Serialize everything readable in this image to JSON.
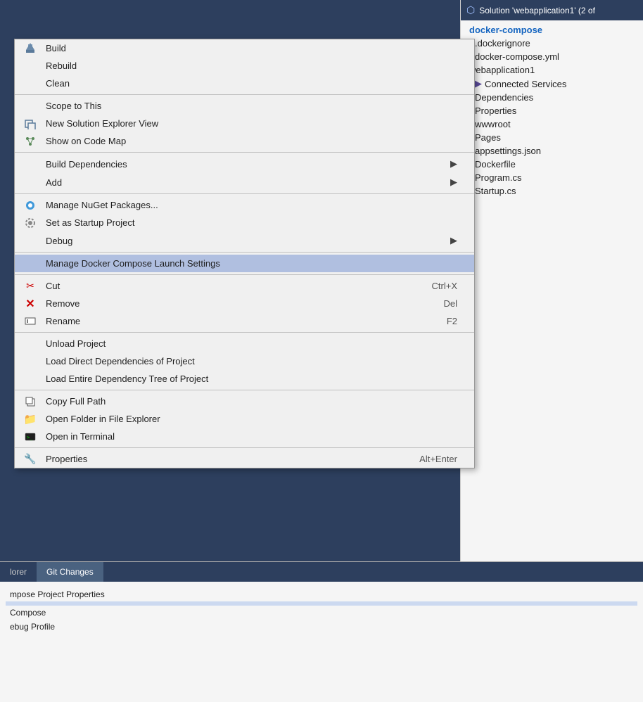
{
  "solution_explorer": {
    "header": "Solution 'webapplication1' (2 of",
    "tree_items": [
      {
        "label": "docker-compose",
        "level": 0,
        "bold": true
      },
      {
        "label": ".dockerignore",
        "level": 1
      },
      {
        "label": "docker-compose.yml",
        "level": 1
      },
      {
        "label": "webapplication1",
        "level": 0
      },
      {
        "label": "Connected Services",
        "level": 1
      },
      {
        "label": "Dependencies",
        "level": 1
      },
      {
        "label": "Properties",
        "level": 1
      },
      {
        "label": "wwwroot",
        "level": 1
      },
      {
        "label": "Pages",
        "level": 1
      },
      {
        "label": "appsettings.json",
        "level": 1
      },
      {
        "label": "Dockerfile",
        "level": 1
      },
      {
        "label": "Program.cs",
        "level": 1
      },
      {
        "label": "Startup.cs",
        "level": 1
      }
    ]
  },
  "context_menu": {
    "items": [
      {
        "id": "build",
        "label": "Build",
        "shortcut": "",
        "has_arrow": false,
        "icon": "build-icon",
        "divider_after": false
      },
      {
        "id": "rebuild",
        "label": "Rebuild",
        "shortcut": "",
        "has_arrow": false,
        "icon": "",
        "divider_after": false
      },
      {
        "id": "clean",
        "label": "Clean",
        "shortcut": "",
        "has_arrow": false,
        "icon": "",
        "divider_after": true
      },
      {
        "id": "scope-to-this",
        "label": "Scope to This",
        "shortcut": "",
        "has_arrow": false,
        "icon": "",
        "divider_after": false
      },
      {
        "id": "new-solution-explorer-view",
        "label": "New Solution Explorer View",
        "shortcut": "",
        "has_arrow": false,
        "icon": "new-solution-icon",
        "divider_after": false
      },
      {
        "id": "show-on-code-map",
        "label": "Show on Code Map",
        "shortcut": "",
        "has_arrow": false,
        "icon": "code-map-icon",
        "divider_after": true
      },
      {
        "id": "build-dependencies",
        "label": "Build Dependencies",
        "shortcut": "",
        "has_arrow": true,
        "icon": "",
        "divider_after": false
      },
      {
        "id": "add",
        "label": "Add",
        "shortcut": "",
        "has_arrow": true,
        "icon": "",
        "divider_after": true
      },
      {
        "id": "manage-nuget",
        "label": "Manage NuGet Packages...",
        "shortcut": "",
        "has_arrow": false,
        "icon": "nuget-icon",
        "divider_after": false
      },
      {
        "id": "set-startup",
        "label": "Set as Startup Project",
        "shortcut": "",
        "has_arrow": false,
        "icon": "gear-icon",
        "divider_after": false
      },
      {
        "id": "debug",
        "label": "Debug",
        "shortcut": "",
        "has_arrow": true,
        "icon": "",
        "divider_after": true
      },
      {
        "id": "manage-docker-compose",
        "label": "Manage Docker Compose Launch Settings",
        "shortcut": "",
        "has_arrow": false,
        "icon": "",
        "divider_after": true,
        "highlighted": true
      },
      {
        "id": "cut",
        "label": "Cut",
        "shortcut": "Ctrl+X",
        "has_arrow": false,
        "icon": "cut-icon",
        "divider_after": false
      },
      {
        "id": "remove",
        "label": "Remove",
        "shortcut": "Del",
        "has_arrow": false,
        "icon": "remove-icon",
        "divider_after": false
      },
      {
        "id": "rename",
        "label": "Rename",
        "shortcut": "F2",
        "has_arrow": false,
        "icon": "rename-icon",
        "divider_after": true
      },
      {
        "id": "unload-project",
        "label": "Unload Project",
        "shortcut": "",
        "has_arrow": false,
        "icon": "",
        "divider_after": false
      },
      {
        "id": "load-direct-deps",
        "label": "Load Direct Dependencies of Project",
        "shortcut": "",
        "has_arrow": false,
        "icon": "",
        "divider_after": false
      },
      {
        "id": "load-entire-dep-tree",
        "label": "Load Entire Dependency Tree of Project",
        "shortcut": "",
        "has_arrow": false,
        "icon": "",
        "divider_after": true
      },
      {
        "id": "copy-full-path",
        "label": "Copy Full Path",
        "shortcut": "",
        "has_arrow": false,
        "icon": "copy-icon",
        "divider_after": false
      },
      {
        "id": "open-folder",
        "label": "Open Folder in File Explorer",
        "shortcut": "",
        "has_arrow": false,
        "icon": "folder-icon",
        "divider_after": false
      },
      {
        "id": "open-terminal",
        "label": "Open in Terminal",
        "shortcut": "",
        "has_arrow": false,
        "icon": "terminal-icon",
        "divider_after": true
      },
      {
        "id": "properties",
        "label": "Properties",
        "shortcut": "Alt+Enter",
        "has_arrow": false,
        "icon": "wrench-icon",
        "divider_after": false
      }
    ]
  },
  "bottom_panel": {
    "tabs": [
      {
        "label": "lorer",
        "active": false
      },
      {
        "label": "Git Changes",
        "active": true
      }
    ],
    "rows": [
      {
        "label": "mpose  Project Properties",
        "selected": false
      },
      {
        "label": "",
        "selected": true
      },
      {
        "label": "Compose",
        "selected": false
      },
      {
        "label": "ebug Profile",
        "selected": false
      }
    ]
  }
}
